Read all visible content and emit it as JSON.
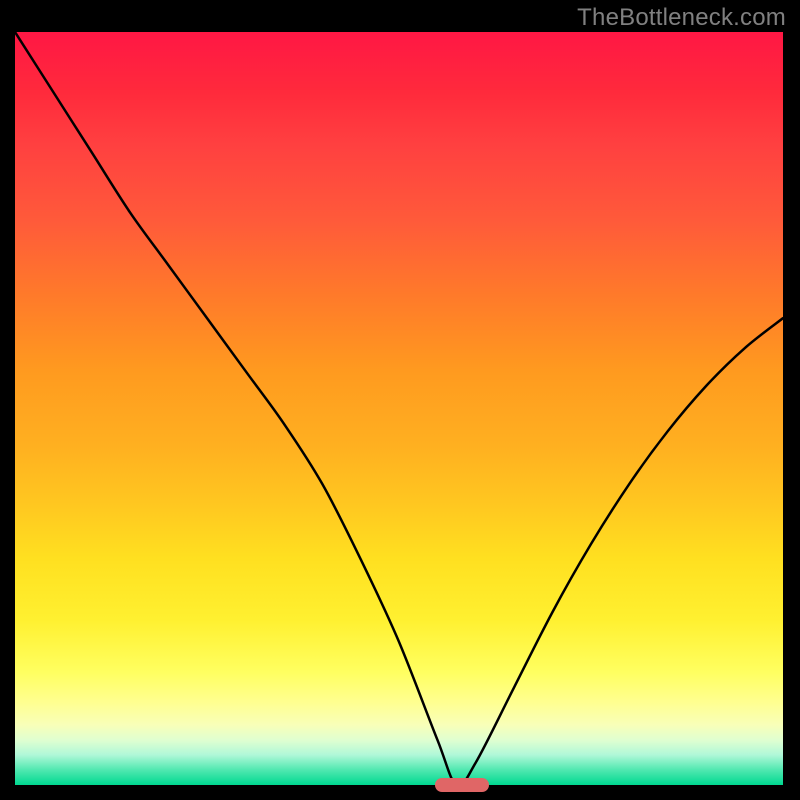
{
  "watermark": "TheBottleneck.com",
  "chart_data": {
    "type": "line",
    "title": "",
    "xlabel": "",
    "ylabel": "",
    "x": [
      0.0,
      0.05,
      0.1,
      0.15,
      0.2,
      0.25,
      0.3,
      0.35,
      0.4,
      0.45,
      0.5,
      0.55,
      0.575,
      0.6,
      0.65,
      0.7,
      0.75,
      0.8,
      0.85,
      0.9,
      0.95,
      1.0
    ],
    "values": [
      1.0,
      0.92,
      0.84,
      0.76,
      0.69,
      0.62,
      0.55,
      0.48,
      0.4,
      0.3,
      0.19,
      0.06,
      0.0,
      0.03,
      0.13,
      0.23,
      0.32,
      0.4,
      0.47,
      0.53,
      0.58,
      0.62
    ],
    "xlim": [
      0,
      1
    ],
    "ylim": [
      0,
      1
    ],
    "optimal_band": {
      "start": 0.545,
      "end": 0.615,
      "y": 0.0
    },
    "background_gradient": [
      "#ff1744",
      "#ffef40",
      "#00d890"
    ],
    "marker_color": "#e06666"
  }
}
